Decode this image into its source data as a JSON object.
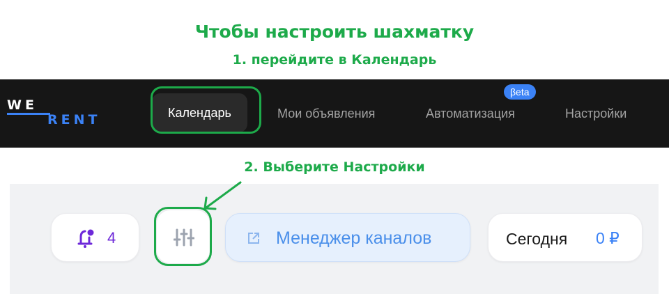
{
  "annotations": {
    "title": "Чтобы настроить шахматку",
    "step1": "1. перейдите в Календарь",
    "step2": "2. Выберите Настройки"
  },
  "logo": {
    "top": "WE",
    "bottom": "RENT"
  },
  "nav": {
    "items": [
      {
        "label": "Календарь",
        "active": true
      },
      {
        "label": "Мои объявления"
      },
      {
        "label": "Автоматизация",
        "badge": "βeta"
      },
      {
        "label": "Настройки"
      }
    ]
  },
  "toolbar": {
    "notifications": {
      "icon": "bell-icon",
      "count": "4"
    },
    "settings": {
      "icon": "sliders-icon"
    },
    "channels": {
      "icon": "external-link-icon",
      "label": "Менеджер каналов"
    },
    "today": {
      "label": "Сегодня",
      "amount": "0 ₽"
    }
  },
  "colors": {
    "annotation": "#1daa4a",
    "accent": "#3b82f6",
    "navbar": "#161616",
    "bell": "#6d28d9"
  }
}
